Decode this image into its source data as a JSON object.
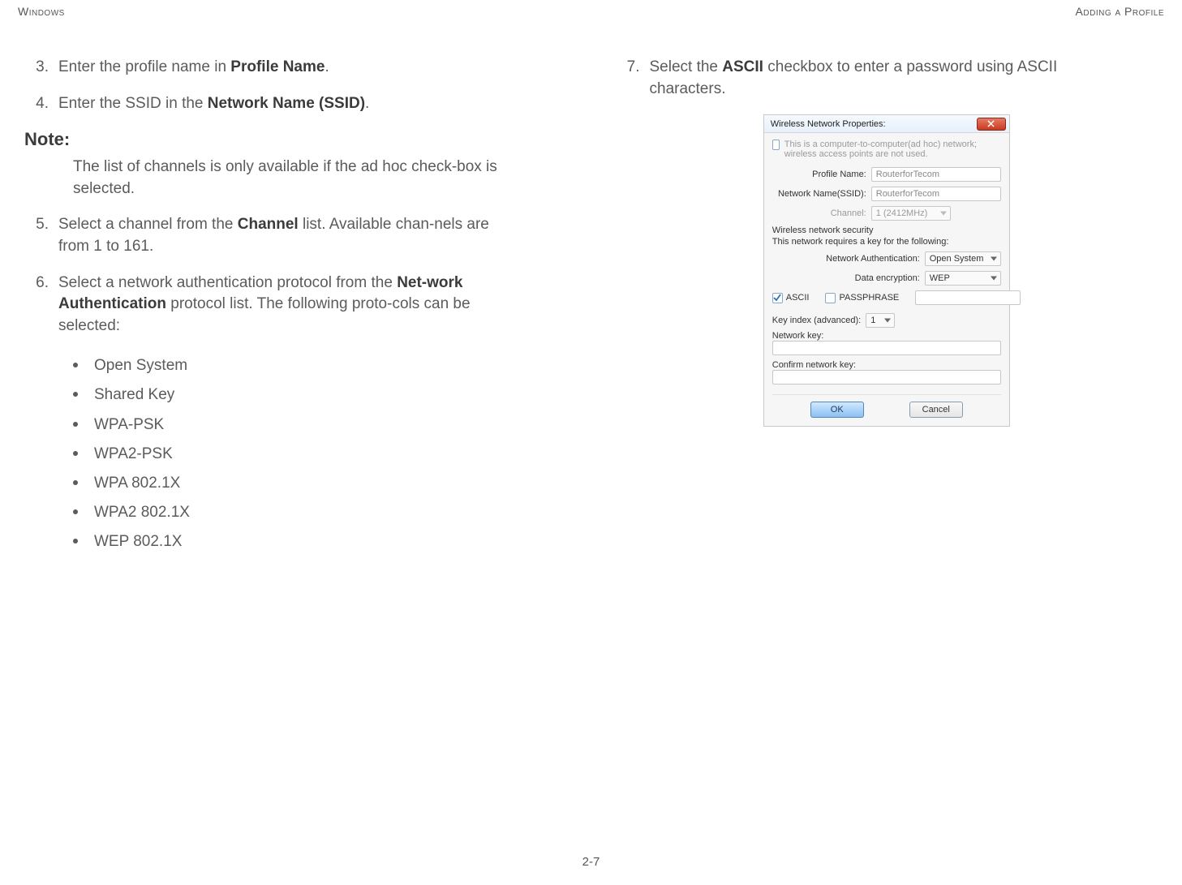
{
  "header": {
    "left": "Windows",
    "right": "Adding a Profile"
  },
  "page_number": "2-7",
  "left_col": {
    "item3": {
      "num": "3.",
      "pre": "Enter the profile name in ",
      "bold": "Profile Name",
      "post": "."
    },
    "item4": {
      "num": "4.",
      "pre": "Enter the SSID in the ",
      "bold": "Network Name (SSID)",
      "post": "."
    },
    "note_label": "Note:",
    "note_body": "The list of channels is only available if the ad hoc check-box is selected.",
    "item5": {
      "num": "5.",
      "pre": "Select a channel from the ",
      "bold": "Channel",
      "post": " list. Available chan-nels are from 1 to 161."
    },
    "item6": {
      "num": "6.",
      "pre": "Select a network authentication protocol from the ",
      "bold": "Net-work Authentication",
      "post": " protocol list. The following proto-cols can be selected:"
    },
    "bullets": [
      "Open System",
      "Shared Key",
      "WPA-PSK",
      "WPA2-PSK",
      "WPA 802.1X",
      "WPA2 802.1X",
      "WEP 802.1X"
    ]
  },
  "right_col": {
    "item7": {
      "num": "7.",
      "pre": "Select the ",
      "bold": "ASCII",
      "post": " checkbox to enter a password using ASCII characters."
    }
  },
  "dialog": {
    "title": "Wireless Network Properties:",
    "adhoc_text": "This is a computer-to-computer(ad hoc) network; wireless access points are not used.",
    "profile_name_label": "Profile Name:",
    "profile_name_value": "RouterforTecom",
    "ssid_label": "Network Name(SSID):",
    "ssid_value": "RouterforTecom",
    "channel_label": "Channel:",
    "channel_value": "1 (2412MHz)",
    "security_section": "Wireless network security",
    "security_sub": "This network requires a key for the following:",
    "auth_label": "Network Authentication:",
    "auth_value": "Open System",
    "encrypt_label": "Data encryption:",
    "encrypt_value": "WEP",
    "ascii_label": "ASCII",
    "passphrase_label": "PASSPHRASE",
    "key_index_label": "Key index (advanced):",
    "key_index_value": "1",
    "network_key_label": "Network key:",
    "confirm_key_label": "Confirm network key:",
    "ok": "OK",
    "cancel": "Cancel"
  }
}
